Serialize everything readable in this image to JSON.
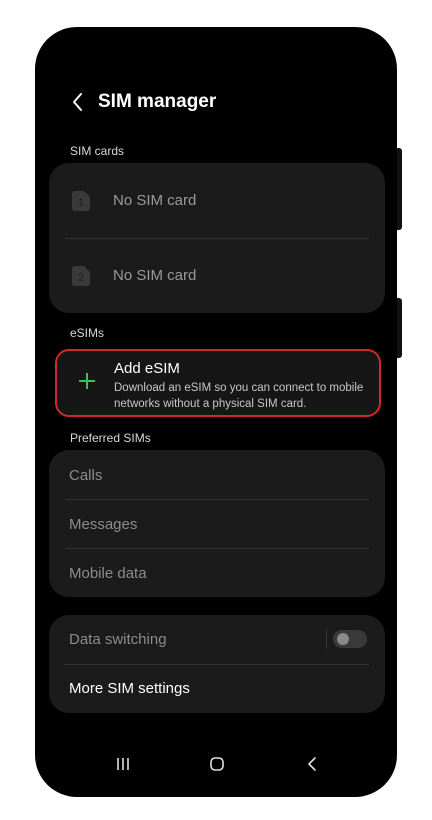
{
  "header": {
    "title": "SIM manager"
  },
  "sim_cards": {
    "section_label": "SIM cards",
    "slots": [
      {
        "number": "1",
        "label": "No SIM card"
      },
      {
        "number": "2",
        "label": "No SIM card"
      }
    ]
  },
  "esims": {
    "section_label": "eSIMs",
    "add": {
      "title": "Add eSIM",
      "description": "Download an eSIM so you can connect to mobile networks without a physical SIM card."
    }
  },
  "preferred_sims": {
    "section_label": "Preferred SIMs",
    "items": [
      "Calls",
      "Messages",
      "Mobile data"
    ]
  },
  "settings": {
    "data_switching": {
      "label": "Data switching",
      "enabled": false
    },
    "more_label": "More SIM settings"
  },
  "colors": {
    "background": "#000000",
    "card": "#1b1b1b",
    "highlight_border": "#d3262e",
    "plus_green": "#3fbf55"
  },
  "icons": [
    "back-icon",
    "sim-card-icon",
    "plus-icon",
    "recents-icon",
    "home-icon",
    "nav-back-icon"
  ]
}
